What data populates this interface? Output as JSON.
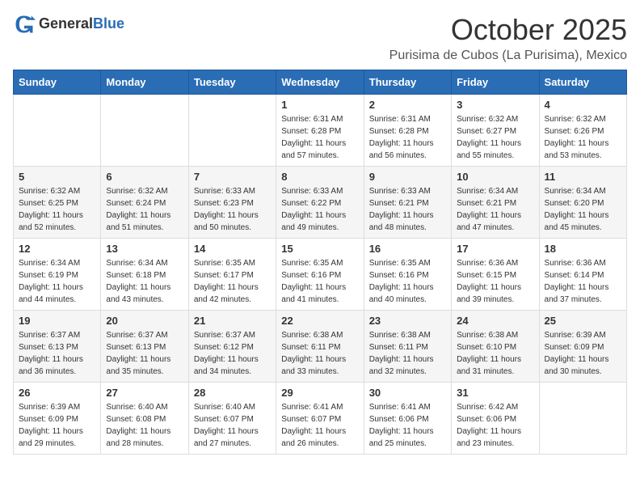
{
  "header": {
    "logo_general": "General",
    "logo_blue": "Blue",
    "month_title": "October 2025",
    "location": "Purisima de Cubos (La Purisima), Mexico"
  },
  "days_of_week": [
    "Sunday",
    "Monday",
    "Tuesday",
    "Wednesday",
    "Thursday",
    "Friday",
    "Saturday"
  ],
  "weeks": [
    [
      {
        "day": "",
        "sunrise": "",
        "sunset": "",
        "daylight": ""
      },
      {
        "day": "",
        "sunrise": "",
        "sunset": "",
        "daylight": ""
      },
      {
        "day": "",
        "sunrise": "",
        "sunset": "",
        "daylight": ""
      },
      {
        "day": "1",
        "sunrise": "Sunrise: 6:31 AM",
        "sunset": "Sunset: 6:28 PM",
        "daylight": "Daylight: 11 hours and 57 minutes."
      },
      {
        "day": "2",
        "sunrise": "Sunrise: 6:31 AM",
        "sunset": "Sunset: 6:28 PM",
        "daylight": "Daylight: 11 hours and 56 minutes."
      },
      {
        "day": "3",
        "sunrise": "Sunrise: 6:32 AM",
        "sunset": "Sunset: 6:27 PM",
        "daylight": "Daylight: 11 hours and 55 minutes."
      },
      {
        "day": "4",
        "sunrise": "Sunrise: 6:32 AM",
        "sunset": "Sunset: 6:26 PM",
        "daylight": "Daylight: 11 hours and 53 minutes."
      }
    ],
    [
      {
        "day": "5",
        "sunrise": "Sunrise: 6:32 AM",
        "sunset": "Sunset: 6:25 PM",
        "daylight": "Daylight: 11 hours and 52 minutes."
      },
      {
        "day": "6",
        "sunrise": "Sunrise: 6:32 AM",
        "sunset": "Sunset: 6:24 PM",
        "daylight": "Daylight: 11 hours and 51 minutes."
      },
      {
        "day": "7",
        "sunrise": "Sunrise: 6:33 AM",
        "sunset": "Sunset: 6:23 PM",
        "daylight": "Daylight: 11 hours and 50 minutes."
      },
      {
        "day": "8",
        "sunrise": "Sunrise: 6:33 AM",
        "sunset": "Sunset: 6:22 PM",
        "daylight": "Daylight: 11 hours and 49 minutes."
      },
      {
        "day": "9",
        "sunrise": "Sunrise: 6:33 AM",
        "sunset": "Sunset: 6:21 PM",
        "daylight": "Daylight: 11 hours and 48 minutes."
      },
      {
        "day": "10",
        "sunrise": "Sunrise: 6:34 AM",
        "sunset": "Sunset: 6:21 PM",
        "daylight": "Daylight: 11 hours and 47 minutes."
      },
      {
        "day": "11",
        "sunrise": "Sunrise: 6:34 AM",
        "sunset": "Sunset: 6:20 PM",
        "daylight": "Daylight: 11 hours and 45 minutes."
      }
    ],
    [
      {
        "day": "12",
        "sunrise": "Sunrise: 6:34 AM",
        "sunset": "Sunset: 6:19 PM",
        "daylight": "Daylight: 11 hours and 44 minutes."
      },
      {
        "day": "13",
        "sunrise": "Sunrise: 6:34 AM",
        "sunset": "Sunset: 6:18 PM",
        "daylight": "Daylight: 11 hours and 43 minutes."
      },
      {
        "day": "14",
        "sunrise": "Sunrise: 6:35 AM",
        "sunset": "Sunset: 6:17 PM",
        "daylight": "Daylight: 11 hours and 42 minutes."
      },
      {
        "day": "15",
        "sunrise": "Sunrise: 6:35 AM",
        "sunset": "Sunset: 6:16 PM",
        "daylight": "Daylight: 11 hours and 41 minutes."
      },
      {
        "day": "16",
        "sunrise": "Sunrise: 6:35 AM",
        "sunset": "Sunset: 6:16 PM",
        "daylight": "Daylight: 11 hours and 40 minutes."
      },
      {
        "day": "17",
        "sunrise": "Sunrise: 6:36 AM",
        "sunset": "Sunset: 6:15 PM",
        "daylight": "Daylight: 11 hours and 39 minutes."
      },
      {
        "day": "18",
        "sunrise": "Sunrise: 6:36 AM",
        "sunset": "Sunset: 6:14 PM",
        "daylight": "Daylight: 11 hours and 37 minutes."
      }
    ],
    [
      {
        "day": "19",
        "sunrise": "Sunrise: 6:37 AM",
        "sunset": "Sunset: 6:13 PM",
        "daylight": "Daylight: 11 hours and 36 minutes."
      },
      {
        "day": "20",
        "sunrise": "Sunrise: 6:37 AM",
        "sunset": "Sunset: 6:13 PM",
        "daylight": "Daylight: 11 hours and 35 minutes."
      },
      {
        "day": "21",
        "sunrise": "Sunrise: 6:37 AM",
        "sunset": "Sunset: 6:12 PM",
        "daylight": "Daylight: 11 hours and 34 minutes."
      },
      {
        "day": "22",
        "sunrise": "Sunrise: 6:38 AM",
        "sunset": "Sunset: 6:11 PM",
        "daylight": "Daylight: 11 hours and 33 minutes."
      },
      {
        "day": "23",
        "sunrise": "Sunrise: 6:38 AM",
        "sunset": "Sunset: 6:11 PM",
        "daylight": "Daylight: 11 hours and 32 minutes."
      },
      {
        "day": "24",
        "sunrise": "Sunrise: 6:38 AM",
        "sunset": "Sunset: 6:10 PM",
        "daylight": "Daylight: 11 hours and 31 minutes."
      },
      {
        "day": "25",
        "sunrise": "Sunrise: 6:39 AM",
        "sunset": "Sunset: 6:09 PM",
        "daylight": "Daylight: 11 hours and 30 minutes."
      }
    ],
    [
      {
        "day": "26",
        "sunrise": "Sunrise: 6:39 AM",
        "sunset": "Sunset: 6:09 PM",
        "daylight": "Daylight: 11 hours and 29 minutes."
      },
      {
        "day": "27",
        "sunrise": "Sunrise: 6:40 AM",
        "sunset": "Sunset: 6:08 PM",
        "daylight": "Daylight: 11 hours and 28 minutes."
      },
      {
        "day": "28",
        "sunrise": "Sunrise: 6:40 AM",
        "sunset": "Sunset: 6:07 PM",
        "daylight": "Daylight: 11 hours and 27 minutes."
      },
      {
        "day": "29",
        "sunrise": "Sunrise: 6:41 AM",
        "sunset": "Sunset: 6:07 PM",
        "daylight": "Daylight: 11 hours and 26 minutes."
      },
      {
        "day": "30",
        "sunrise": "Sunrise: 6:41 AM",
        "sunset": "Sunset: 6:06 PM",
        "daylight": "Daylight: 11 hours and 25 minutes."
      },
      {
        "day": "31",
        "sunrise": "Sunrise: 6:42 AM",
        "sunset": "Sunset: 6:06 PM",
        "daylight": "Daylight: 11 hours and 23 minutes."
      },
      {
        "day": "",
        "sunrise": "",
        "sunset": "",
        "daylight": ""
      }
    ]
  ]
}
